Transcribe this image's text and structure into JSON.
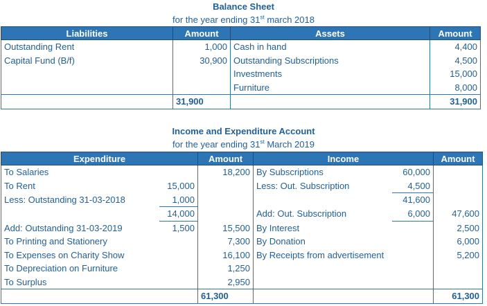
{
  "balance_sheet": {
    "title": "Balance Sheet",
    "subtitle_pre": "for the year ending 31",
    "subtitle_sup": "st",
    "subtitle_post": " march 2018",
    "headers": {
      "liabilities": "Liabilities",
      "amount1": "Amount",
      "assets": "Assets",
      "amount2": "Amount"
    },
    "liabilities": [
      {
        "label": "Outstanding Rent",
        "amount": "1,000"
      },
      {
        "label": "Capital Fund (B/f)",
        "amount": "30,900"
      }
    ],
    "assets": [
      {
        "label": "Cash in hand",
        "amount": "4,400"
      },
      {
        "label": "Outstanding Subscriptions",
        "amount": "4,500"
      },
      {
        "label": "Investments",
        "amount": "15,000"
      },
      {
        "label": "Furniture",
        "amount": "8,000"
      }
    ],
    "total_left": "31,900",
    "total_right": "31,900"
  },
  "ie_account": {
    "title": "Income and Expenditure Account",
    "subtitle_pre": "for the year ending 31",
    "subtitle_sup": "st",
    "subtitle_post": " March 2019",
    "headers": {
      "expenditure": "Expenditure",
      "amount1": "Amount",
      "income": "Income",
      "amount2": "Amount"
    },
    "rows": [
      {
        "exp": "To Salaries",
        "exp_sub": "",
        "exp_amt": "18,200",
        "inc": "By Subscriptions",
        "inc_sub": "60,000",
        "inc_amt": ""
      },
      {
        "exp": "To Rent",
        "exp_sub": "15,000",
        "exp_amt": "",
        "inc": "Less: Out. Subscription",
        "inc_sub": "4,500",
        "inc_amt": ""
      },
      {
        "exp": "Less: Outstanding 31-03-2018",
        "exp_sub": "1,000",
        "exp_amt": "",
        "inc": "",
        "inc_sub": "41,600",
        "inc_amt": ""
      },
      {
        "exp": "",
        "exp_sub": "14,000",
        "exp_amt": "",
        "inc": "Add: Out. Subscription",
        "inc_sub": "6,000",
        "inc_amt": "47,600"
      },
      {
        "exp": "Add: Outstanding 31-03-2019",
        "exp_sub": "1,500",
        "exp_amt": "15,500",
        "inc": "By Interest",
        "inc_sub": "",
        "inc_amt": "2,500"
      },
      {
        "exp": "To Printing and Stationery",
        "exp_sub": "",
        "exp_amt": "7,300",
        "inc": "By Donation",
        "inc_sub": "",
        "inc_amt": "6,000"
      },
      {
        "exp": "To Expenses on Charity Show",
        "exp_sub": "",
        "exp_amt": "16,100",
        "inc": "By Receipts from advertisement",
        "inc_sub": "",
        "inc_amt": "5,200"
      },
      {
        "exp": "To Depreciation on Furniture",
        "exp_sub": "",
        "exp_amt": "1,250",
        "inc": "",
        "inc_sub": "",
        "inc_amt": ""
      },
      {
        "exp": "To Surplus",
        "exp_sub": "",
        "exp_amt": "2,950",
        "inc": "",
        "inc_sub": "",
        "inc_amt": ""
      }
    ],
    "total_left": "61,300",
    "total_right": "61,300"
  }
}
